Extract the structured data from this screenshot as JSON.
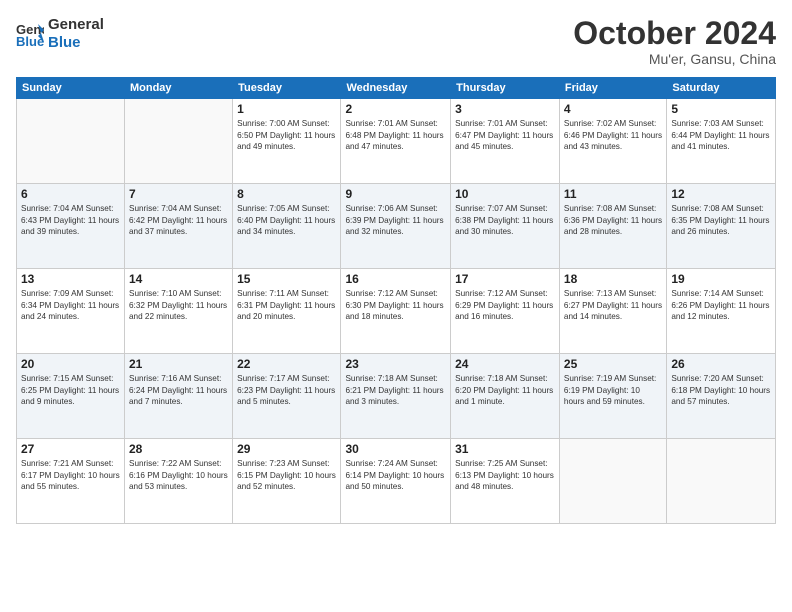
{
  "logo": {
    "line1": "General",
    "line2": "Blue"
  },
  "title": "October 2024",
  "subtitle": "Mu'er, Gansu, China",
  "headers": [
    "Sunday",
    "Monday",
    "Tuesday",
    "Wednesday",
    "Thursday",
    "Friday",
    "Saturday"
  ],
  "weeks": [
    [
      {
        "day": "",
        "info": ""
      },
      {
        "day": "",
        "info": ""
      },
      {
        "day": "1",
        "info": "Sunrise: 7:00 AM\nSunset: 6:50 PM\nDaylight: 11 hours and 49 minutes."
      },
      {
        "day": "2",
        "info": "Sunrise: 7:01 AM\nSunset: 6:48 PM\nDaylight: 11 hours and 47 minutes."
      },
      {
        "day": "3",
        "info": "Sunrise: 7:01 AM\nSunset: 6:47 PM\nDaylight: 11 hours and 45 minutes."
      },
      {
        "day": "4",
        "info": "Sunrise: 7:02 AM\nSunset: 6:46 PM\nDaylight: 11 hours and 43 minutes."
      },
      {
        "day": "5",
        "info": "Sunrise: 7:03 AM\nSunset: 6:44 PM\nDaylight: 11 hours and 41 minutes."
      }
    ],
    [
      {
        "day": "6",
        "info": "Sunrise: 7:04 AM\nSunset: 6:43 PM\nDaylight: 11 hours and 39 minutes."
      },
      {
        "day": "7",
        "info": "Sunrise: 7:04 AM\nSunset: 6:42 PM\nDaylight: 11 hours and 37 minutes."
      },
      {
        "day": "8",
        "info": "Sunrise: 7:05 AM\nSunset: 6:40 PM\nDaylight: 11 hours and 34 minutes."
      },
      {
        "day": "9",
        "info": "Sunrise: 7:06 AM\nSunset: 6:39 PM\nDaylight: 11 hours and 32 minutes."
      },
      {
        "day": "10",
        "info": "Sunrise: 7:07 AM\nSunset: 6:38 PM\nDaylight: 11 hours and 30 minutes."
      },
      {
        "day": "11",
        "info": "Sunrise: 7:08 AM\nSunset: 6:36 PM\nDaylight: 11 hours and 28 minutes."
      },
      {
        "day": "12",
        "info": "Sunrise: 7:08 AM\nSunset: 6:35 PM\nDaylight: 11 hours and 26 minutes."
      }
    ],
    [
      {
        "day": "13",
        "info": "Sunrise: 7:09 AM\nSunset: 6:34 PM\nDaylight: 11 hours and 24 minutes."
      },
      {
        "day": "14",
        "info": "Sunrise: 7:10 AM\nSunset: 6:32 PM\nDaylight: 11 hours and 22 minutes."
      },
      {
        "day": "15",
        "info": "Sunrise: 7:11 AM\nSunset: 6:31 PM\nDaylight: 11 hours and 20 minutes."
      },
      {
        "day": "16",
        "info": "Sunrise: 7:12 AM\nSunset: 6:30 PM\nDaylight: 11 hours and 18 minutes."
      },
      {
        "day": "17",
        "info": "Sunrise: 7:12 AM\nSunset: 6:29 PM\nDaylight: 11 hours and 16 minutes."
      },
      {
        "day": "18",
        "info": "Sunrise: 7:13 AM\nSunset: 6:27 PM\nDaylight: 11 hours and 14 minutes."
      },
      {
        "day": "19",
        "info": "Sunrise: 7:14 AM\nSunset: 6:26 PM\nDaylight: 11 hours and 12 minutes."
      }
    ],
    [
      {
        "day": "20",
        "info": "Sunrise: 7:15 AM\nSunset: 6:25 PM\nDaylight: 11 hours and 9 minutes."
      },
      {
        "day": "21",
        "info": "Sunrise: 7:16 AM\nSunset: 6:24 PM\nDaylight: 11 hours and 7 minutes."
      },
      {
        "day": "22",
        "info": "Sunrise: 7:17 AM\nSunset: 6:23 PM\nDaylight: 11 hours and 5 minutes."
      },
      {
        "day": "23",
        "info": "Sunrise: 7:18 AM\nSunset: 6:21 PM\nDaylight: 11 hours and 3 minutes."
      },
      {
        "day": "24",
        "info": "Sunrise: 7:18 AM\nSunset: 6:20 PM\nDaylight: 11 hours and 1 minute."
      },
      {
        "day": "25",
        "info": "Sunrise: 7:19 AM\nSunset: 6:19 PM\nDaylight: 10 hours and 59 minutes."
      },
      {
        "day": "26",
        "info": "Sunrise: 7:20 AM\nSunset: 6:18 PM\nDaylight: 10 hours and 57 minutes."
      }
    ],
    [
      {
        "day": "27",
        "info": "Sunrise: 7:21 AM\nSunset: 6:17 PM\nDaylight: 10 hours and 55 minutes."
      },
      {
        "day": "28",
        "info": "Sunrise: 7:22 AM\nSunset: 6:16 PM\nDaylight: 10 hours and 53 minutes."
      },
      {
        "day": "29",
        "info": "Sunrise: 7:23 AM\nSunset: 6:15 PM\nDaylight: 10 hours and 52 minutes."
      },
      {
        "day": "30",
        "info": "Sunrise: 7:24 AM\nSunset: 6:14 PM\nDaylight: 10 hours and 50 minutes."
      },
      {
        "day": "31",
        "info": "Sunrise: 7:25 AM\nSunset: 6:13 PM\nDaylight: 10 hours and 48 minutes."
      },
      {
        "day": "",
        "info": ""
      },
      {
        "day": "",
        "info": ""
      }
    ]
  ]
}
